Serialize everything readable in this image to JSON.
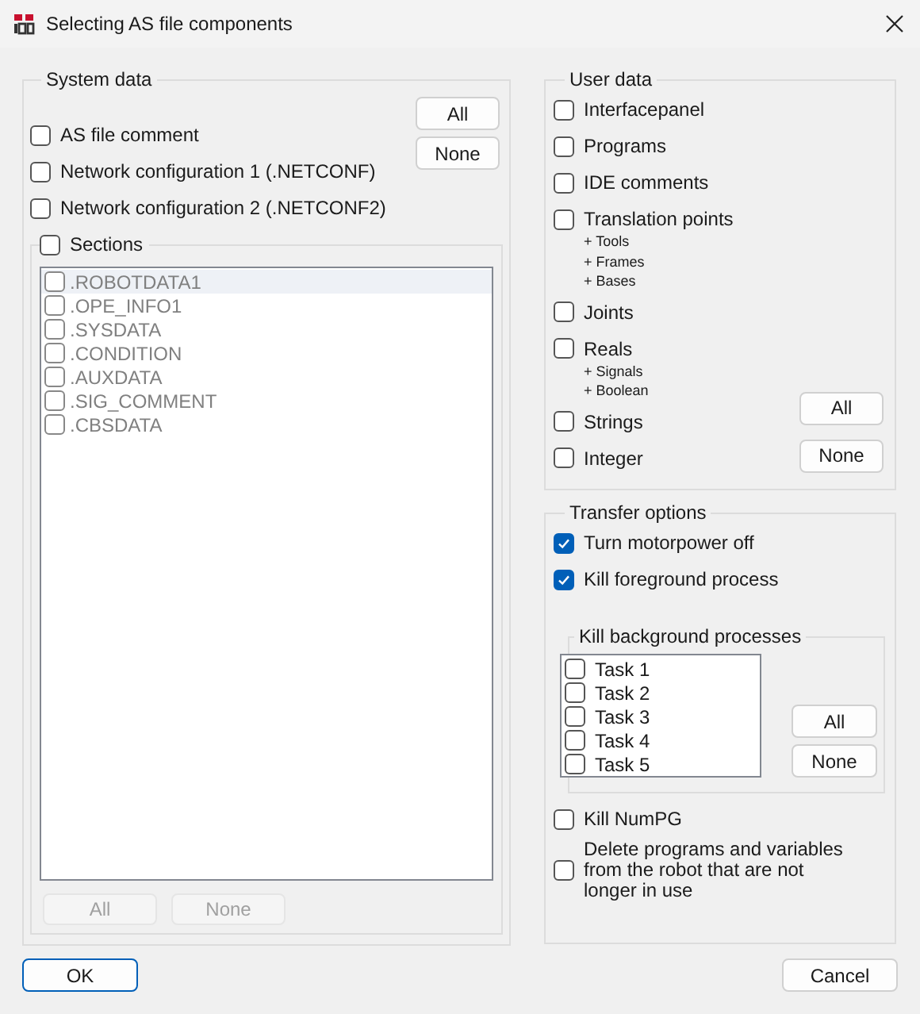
{
  "window": {
    "title": "Selecting AS file components"
  },
  "system_data": {
    "title": "System data",
    "items": [
      {
        "label": "AS file comment",
        "checked": false
      },
      {
        "label": "Network configuration 1 (.NETCONF)",
        "checked": false
      },
      {
        "label": "Network configuration 2 (.NETCONF2)",
        "checked": false
      }
    ],
    "buttons": [
      {
        "label": "All",
        "disabled": false
      },
      {
        "label": "None",
        "disabled": false
      }
    ],
    "sections": {
      "label": "Sections",
      "checked": false,
      "items": [
        {
          "label": ".ROBOTDATA1",
          "checked": false,
          "selected": true,
          "disabled": true
        },
        {
          "label": ".OPE_INFO1",
          "checked": false,
          "selected": false,
          "disabled": true
        },
        {
          "label": ".SYSDATA",
          "checked": false,
          "selected": false,
          "disabled": true
        },
        {
          "label": ".CONDITION",
          "checked": false,
          "selected": false,
          "disabled": true
        },
        {
          "label": ".AUXDATA",
          "checked": false,
          "selected": false,
          "disabled": true
        },
        {
          "label": ".SIG_COMMENT",
          "checked": false,
          "selected": false,
          "disabled": true
        },
        {
          "label": ".CBSDATA",
          "checked": false,
          "selected": false,
          "disabled": true
        }
      ],
      "buttons": [
        {
          "label": "All",
          "disabled": true
        },
        {
          "label": "None",
          "disabled": true
        }
      ]
    }
  },
  "user_data": {
    "title": "User data",
    "items": [
      {
        "label": "Interfacepanel",
        "checked": false
      },
      {
        "label": "Programs",
        "checked": false
      },
      {
        "label": "IDE comments",
        "checked": false
      },
      {
        "label": "Translation points",
        "checked": false,
        "notes": [
          "+ Tools",
          "+ Frames",
          "+ Bases"
        ]
      },
      {
        "label": "Joints",
        "checked": false
      },
      {
        "label": "Reals",
        "checked": false,
        "notes": [
          "+ Signals",
          "+ Boolean"
        ]
      },
      {
        "label": "Strings",
        "checked": false
      },
      {
        "label": "Integer",
        "checked": false
      }
    ],
    "buttons": [
      {
        "label": "All",
        "disabled": false
      },
      {
        "label": "None",
        "disabled": false
      }
    ]
  },
  "transfer_options": {
    "title": "Transfer options",
    "items": [
      {
        "label": "Turn motorpower off",
        "checked": true
      },
      {
        "label": "Kill foreground process",
        "checked": true
      }
    ],
    "background": {
      "title": "Kill background processes",
      "tasks": [
        {
          "label": "Task 1",
          "checked": false
        },
        {
          "label": "Task 2",
          "checked": false
        },
        {
          "label": "Task 3",
          "checked": false
        },
        {
          "label": "Task 4",
          "checked": false
        },
        {
          "label": "Task 5",
          "checked": false
        }
      ],
      "buttons": [
        {
          "label": "All",
          "disabled": false
        },
        {
          "label": "None",
          "disabled": false
        }
      ]
    },
    "more_items": [
      {
        "label": "Kill NumPG",
        "checked": false
      },
      {
        "label": "Delete programs and variables from the robot that are not longer in use",
        "checked": false
      }
    ]
  },
  "buttons": [
    {
      "label": "OK",
      "default": true
    },
    {
      "label": "Cancel",
      "default": false
    }
  ]
}
